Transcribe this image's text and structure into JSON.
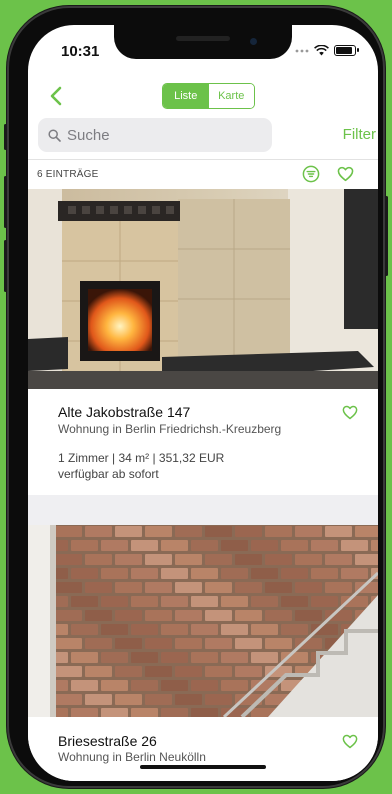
{
  "status": {
    "time": "10:31",
    "battery_level": 0.9
  },
  "nav": {
    "segments": [
      {
        "label": "Liste",
        "active": true
      },
      {
        "label": "Karte",
        "active": false
      }
    ],
    "back_icon": "chevron-left-icon"
  },
  "search": {
    "placeholder": "Suche",
    "value": "",
    "filter_label": "Filter"
  },
  "results": {
    "count_label": "6 EINTRÄGE"
  },
  "listings": [
    {
      "title": "Alte Jakobstraße 147",
      "subtitle": "Wohnung in Berlin Friedrichsh.-Kreuzberg",
      "details": "1  Zimmer | 34 m² | 351,32  EUR",
      "availability": "verfügbar ab sofort"
    },
    {
      "title": "Briesestraße 26",
      "subtitle": "Wohnung in Berlin Neukölln"
    }
  ],
  "colors": {
    "accent": "#6cc24a",
    "text": "#111111",
    "muted": "#555555"
  }
}
